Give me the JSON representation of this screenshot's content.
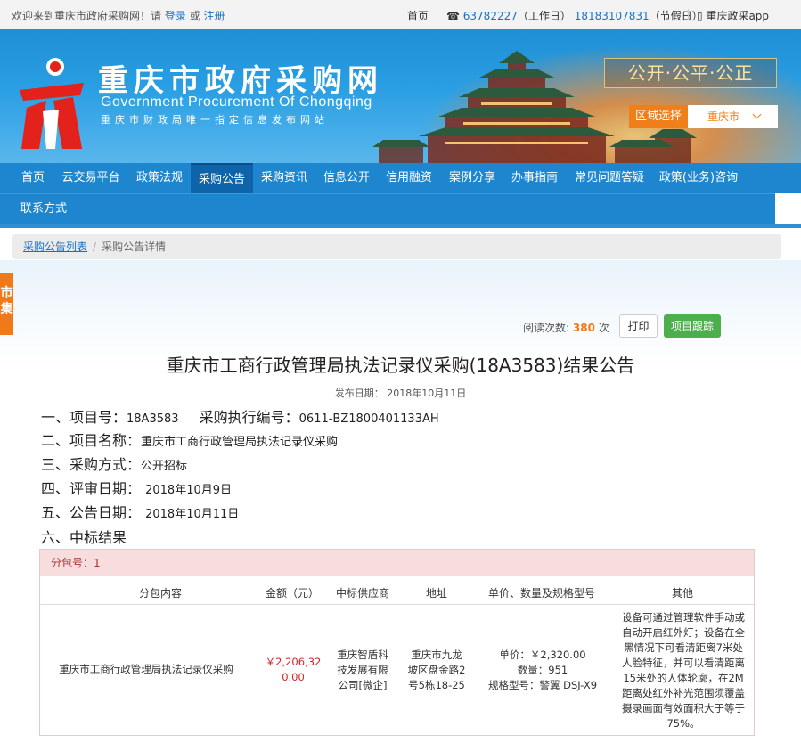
{
  "topbar": {
    "welcome": "欢迎来到重庆市政府采购网！请",
    "login": "登录",
    "or": "或",
    "register": "注册",
    "home": "首页",
    "phone_work": "63782227",
    "work_label": "（工作日）",
    "phone_holiday": "18183107831",
    "holiday_label": "（节假日）",
    "app": "重庆政采app"
  },
  "banner": {
    "title": "重庆市政府采购网",
    "title_en": "Government Procurement Of Chongqing",
    "subtitle": "重庆市财政局唯一指定信息发布网站",
    "slogan": "公开·公平·公正",
    "region_button": "区域选择",
    "region_value": "重庆市"
  },
  "nav": {
    "items": [
      "首页",
      "云交易平台",
      "政策法规",
      "采购公告",
      "采购资讯",
      "信息公开",
      "信用融资",
      "案例分享",
      "办事指南",
      "常见问题答疑",
      "政策(业务)咨询"
    ],
    "row2": [
      "联系方式"
    ],
    "active": "采购公告"
  },
  "breadcrumb": {
    "list": "采购公告列表",
    "current": "采购公告详情"
  },
  "sidetab": "市集",
  "stats": {
    "reads_label": "阅读次数:",
    "reads_count": "380",
    "reads_unit": "次",
    "print": "打印",
    "track": "项目跟踪"
  },
  "notice": {
    "title": "重庆市工商行政管理局执法记录仪采购(18A3583)结果公告",
    "publish_date": "发布日期： 2018年10月11日",
    "l1_label": "一、项目号：",
    "l1_value": "18A3583",
    "l1_label2": "采购执行编号：",
    "l1_value2": "0611-BZ1800401133AH",
    "l2_label": "二、项目名称：",
    "l2_value": "重庆市工商行政管理局执法记录仪采购",
    "l3_label": "三、采购方式：",
    "l3_value": "公开招标",
    "l4_label": "四、评审日期：",
    "l4_value": "2018年10月9日",
    "l5_label": "五、公告日期：",
    "l5_value": "2018年10月11日",
    "l6_label": "六、中标结果"
  },
  "result": {
    "package": "分包号：1",
    "headers": [
      "分包内容",
      "金额（元）",
      "中标供应商",
      "地址",
      "单价、数量及规格型号",
      "其他"
    ],
    "row": {
      "content": "重庆市工商行政管理局执法记录仪采购",
      "amount_1": "￥2,206,32",
      "amount_2": "0.00",
      "supplier_1": "重庆智盾科",
      "supplier_2": "技发展有限",
      "supplier_3": "公司[微企]",
      "address_1": "重庆市九龙",
      "address_2": "坡区盘金路2",
      "address_3": "号5栋18-25",
      "price": "单价：￥2,320.00",
      "qty": "数量：951",
      "model": "规格型号：警翼 DSJ-X9",
      "other": [
        "设备可通过管理软件手动或",
        "自动开启红外灯；设备在全",
        "黑情况下可看清距离7米处",
        "人脸特征，并可以看清距离",
        "15米处的人体轮廓，在2M",
        "距离处红外补光范围须覆盖",
        "摄录画面有效面积大于等于",
        "75%。"
      ]
    }
  },
  "colors": {
    "nav": "#1e86cf",
    "accent_orange": "#f07a1a",
    "track_green": "#4cae4c",
    "money_red": "#d0262a"
  }
}
